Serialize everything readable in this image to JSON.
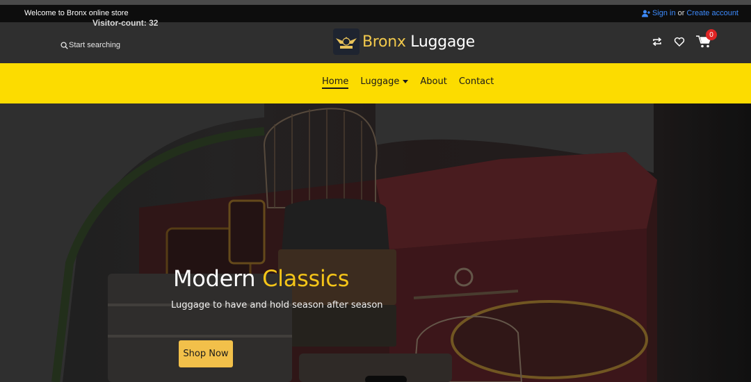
{
  "topbar": {
    "welcome": "Welcome to Bronx online store",
    "visitor_count": "Visitor-count: 32",
    "sign_in": "Sign in",
    "or": "or",
    "create_account": "Create account"
  },
  "header": {
    "search_placeholder": "Start searching",
    "brand_first": "Bronx",
    "brand_second": "Luggage",
    "cart_count": "0",
    "icons": [
      "compare-icon",
      "heart-icon",
      "cart-icon"
    ]
  },
  "nav": {
    "items": [
      {
        "label": "Home",
        "active": true
      },
      {
        "label": "Luggage",
        "dropdown": true
      },
      {
        "label": "About"
      },
      {
        "label": "Contact"
      }
    ]
  },
  "hero": {
    "title_white": "Modern",
    "title_accent": "Classics",
    "subtitle": "Luggage to have and hold season after season",
    "cta": "Shop Now"
  },
  "colors": {
    "accent_yellow": "#fcdc00",
    "button_yellow": "#f2c04a",
    "link_blue": "#3d8bfd",
    "badge_red": "#e02424"
  }
}
